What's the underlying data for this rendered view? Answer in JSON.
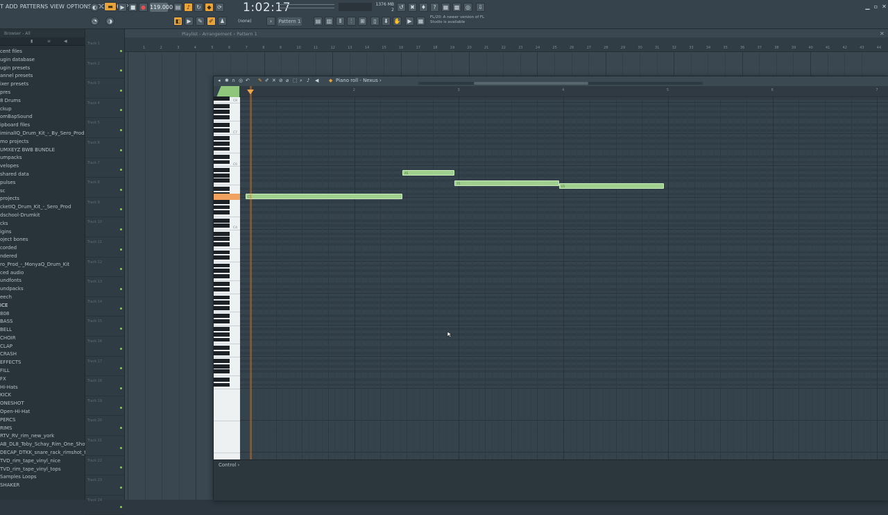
{
  "menu": [
    "T",
    "ADD",
    "PATTERNS",
    "VIEW",
    "OPTIONS",
    "TOOLS",
    "HELP"
  ],
  "transport": {
    "tempo": "119.000",
    "time": "1:02:17",
    "memory": "1376 MB",
    "cpu": "2",
    "pattern": "Pattern 1",
    "snap": "(none)"
  },
  "news": [
    "FL/20: A newer version of FL",
    "Studio is available"
  ],
  "browser": {
    "title": "Browser - All",
    "items": [
      "cent files",
      "ugin database",
      "ugin presets",
      "annel presets",
      "ixer presets",
      "pres",
      "8 Drums",
      "ckup",
      "omBapSound",
      "ipboard files",
      "iminalIQ_Drum_Kit_-_By_Sero_Prod",
      "mo projects",
      "UMXEYZ BWB BUNDLE",
      "umpacks",
      "velopes",
      "shared data",
      "pulses",
      "sc",
      "projects",
      "cketIQ_Drum_Kit_-_Sero_Prod",
      "dschool-Drumkit",
      "cks",
      "igins",
      "oject bones",
      "corded",
      "ndered",
      "ro_Prod_-_MonyaQ_Drum_Kit",
      "ced audio",
      "undfonts",
      "undpacks",
      "eech",
      "ICE",
      "808",
      "BASS",
      "BELL",
      "CHOIR",
      "CLAP",
      "CRASH",
      "EFFECTS",
      "FILL",
      "FX",
      "Hi-Hats",
      "KICK",
      "ONESHOT",
      "Open-Hi-Hat",
      "PERCS",
      "RIMS",
      "RTV_RV_rim_new_york",
      "AB_DL8_Toby_Schay_Rim_One_Shot_Attention",
      "DECAP_DTKK_snare_rack_rimshot_tap",
      "TVD_rim_tape_vinyl_nice",
      "TVD_rim_tape_vinyl_tops",
      "Samples Loops",
      "SHAKER"
    ],
    "selected": "ICE"
  },
  "playlist": {
    "title": "Playlist - Arrangement › Pattern 1",
    "tracks": [
      "Track 1",
      "Track 2",
      "Track 3",
      "Track 4",
      "Track 5",
      "Track 6",
      "Track 7",
      "Track 8",
      "Track 9",
      "Track 10",
      "Track 11",
      "Track 12",
      "Track 13",
      "Track 14",
      "Track 15",
      "Track 16",
      "Track 17",
      "Track 18",
      "Track 19",
      "Track 20",
      "Track 21",
      "Track 22",
      "Track 23",
      "Track 24"
    ],
    "bars": [
      "1",
      "2",
      "3",
      "4",
      "5",
      "6",
      "7",
      "8",
      "9",
      "10",
      "11",
      "12",
      "13",
      "14",
      "15",
      "16",
      "17",
      "18",
      "19",
      "20",
      "21",
      "22",
      "23",
      "24",
      "25",
      "26",
      "27",
      "28",
      "29",
      "30",
      "31",
      "32",
      "33",
      "34",
      "35",
      "36",
      "37",
      "38",
      "39",
      "40",
      "41",
      "42",
      "43",
      "44"
    ]
  },
  "pianoroll": {
    "title": "Piano roll - Nexus ›",
    "bars": [
      "2",
      "3",
      "4",
      "5",
      "6",
      "7"
    ],
    "octaves": [
      "C8",
      "C7",
      "C6",
      "C5",
      "C4"
    ],
    "control_label": "Control",
    "notes": [
      {
        "label": "C5",
        "start_step": 0,
        "length_steps": 24,
        "row": "C5"
      },
      {
        "label": "A5",
        "start_step": 24,
        "length_steps": 8,
        "row": "A5"
      },
      {
        "label": "F5",
        "start_step": 32,
        "length_steps": 16,
        "row": "F5"
      },
      {
        "label": "E5",
        "start_step": 48,
        "length_steps": 16,
        "row": "E5"
      }
    ]
  },
  "colors": {
    "accent": "#e8a33a",
    "note": "#9fd08d",
    "panel": "#34424b"
  }
}
